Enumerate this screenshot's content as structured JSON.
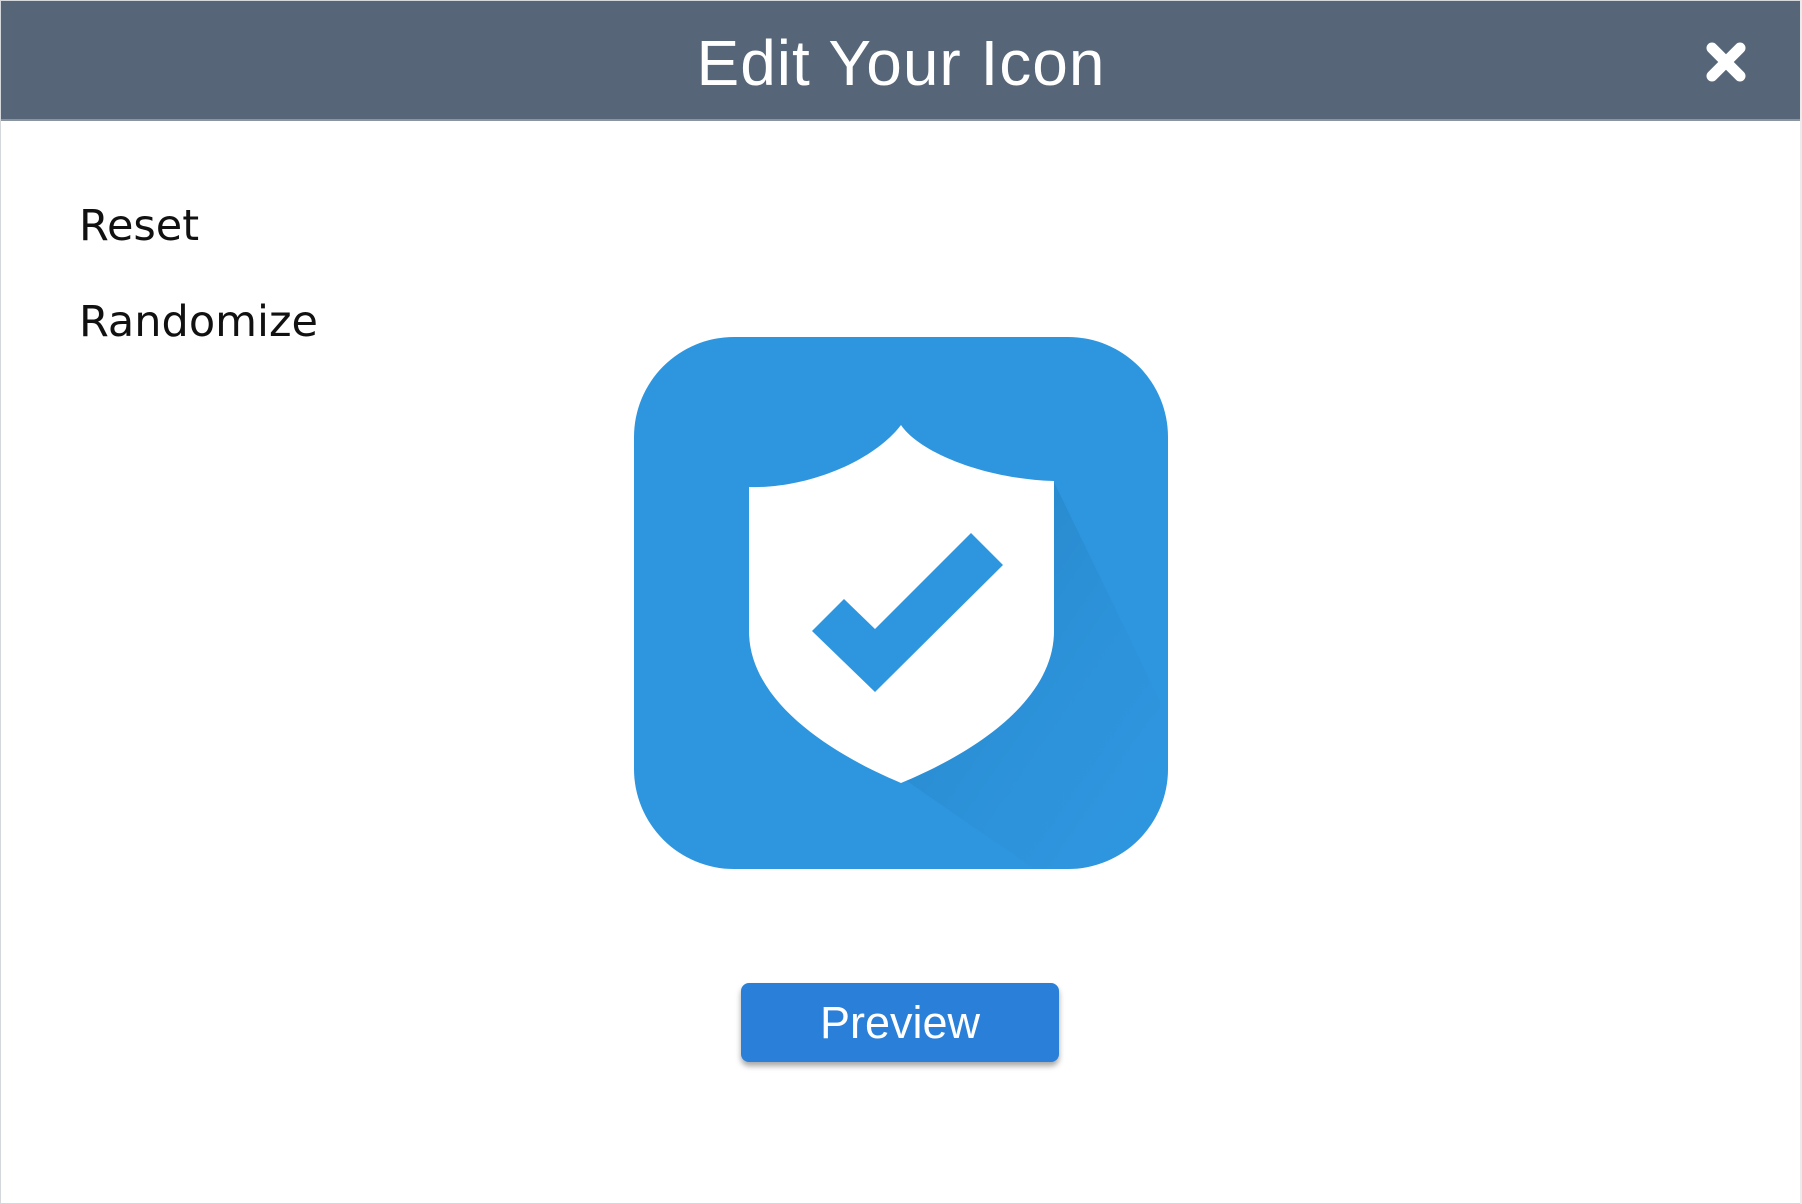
{
  "dialog": {
    "title": "Edit Your Icon",
    "close_icon": "close-icon"
  },
  "menu": {
    "items": [
      {
        "label": "Reset"
      },
      {
        "label": "Randomize"
      }
    ]
  },
  "icon_preview": {
    "icon": "shield-check-icon",
    "background_color": "#2e96df",
    "shield_color": "#ffffff",
    "check_color": "#2e96df"
  },
  "actions": {
    "preview_label": "Preview",
    "preview_color": "#2a7fd9"
  },
  "colors": {
    "titlebar": "#566577",
    "title_text": "#ffffff"
  }
}
